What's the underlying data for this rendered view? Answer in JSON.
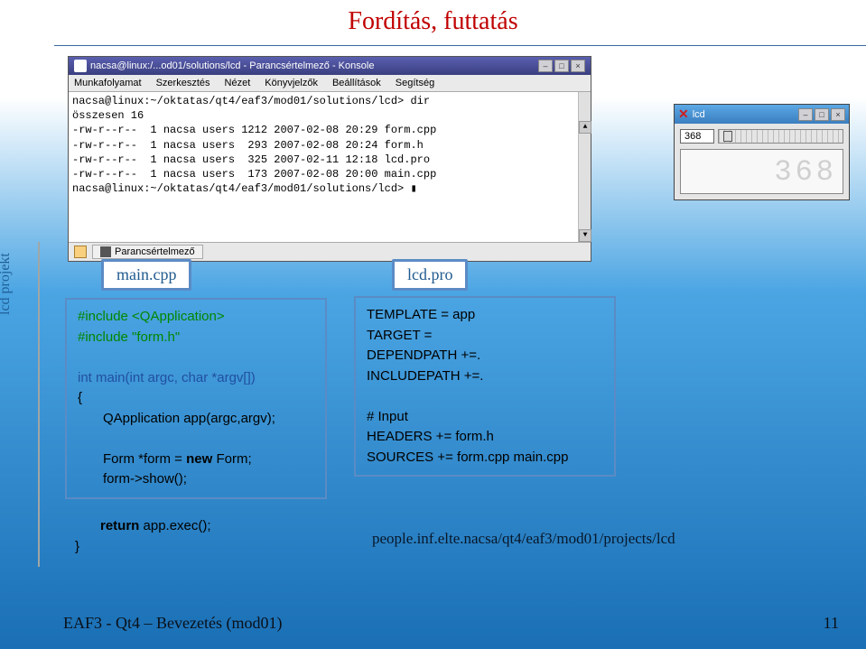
{
  "slide": {
    "title": "Fordítás, futtatás",
    "sidebar_label": "lcd projekt",
    "footer": "EAF3 - Qt4 – Bevezetés (mod01)",
    "page_number": "11",
    "url": "people.inf.elte.nacsa/qt4/eaf3/mod01/projects/lcd"
  },
  "terminal": {
    "title": "nacsa@linux:/...od01/solutions/lcd - Parancsértelmező - Konsole",
    "menus": [
      "Munkafolyamat",
      "Szerkesztés",
      "Nézet",
      "Könyvjelzők",
      "Beállítások",
      "Segítség"
    ],
    "lines": [
      "nacsa@linux:~/oktatas/qt4/eaf3/mod01/solutions/lcd> dir",
      "összesen 16",
      "-rw-r--r--  1 nacsa users 1212 2007-02-08 20:29 form.cpp",
      "-rw-r--r--  1 nacsa users  293 2007-02-08 20:24 form.h",
      "-rw-r--r--  1 nacsa users  325 2007-02-11 12:18 lcd.pro",
      "-rw-r--r--  1 nacsa users  173 2007-02-08 20:00 main.cpp",
      "nacsa@linux:~/oktatas/qt4/eaf3/mod01/solutions/lcd> ▮"
    ],
    "taskbar_button": "Parancsértelmező"
  },
  "lcd_window": {
    "title": "lcd",
    "slider_value": "368",
    "display_value": "368"
  },
  "labels": {
    "main_cpp": "main.cpp",
    "lcd_pro": "lcd.pro"
  },
  "code_left": {
    "l1": "#include <QApplication>",
    "l2": "#include \"form.h\"",
    "l3": "int main(int argc, char *argv[])",
    "l4": "{",
    "l5": "QApplication app(argc,argv);",
    "l6": "Form *form = ",
    "l6b": "new",
    "l6c": " Form;",
    "l7": "form->show();",
    "ret1": "return",
    "ret2": " app.exec();",
    "brace": "}"
  },
  "code_right": {
    "l1": "TEMPLATE = app",
    "l2": "TARGET = ",
    "l3": "DEPENDPATH +=.",
    "l4": "INCLUDEPATH +=.",
    "l5": "# Input",
    "l6": "HEADERS += form.h",
    "l7": "SOURCES += form.cpp main.cpp"
  }
}
